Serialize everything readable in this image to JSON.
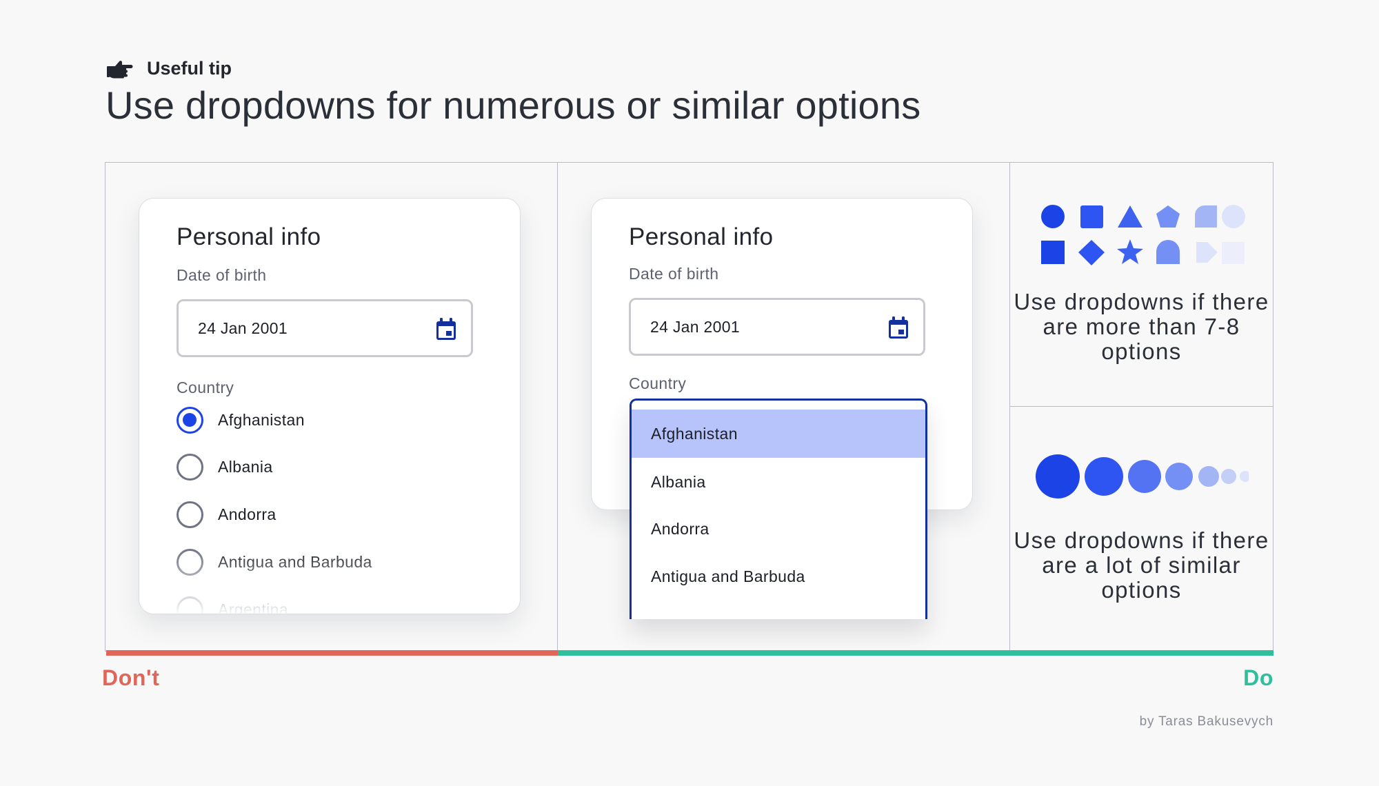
{
  "header": {
    "tip_label": "Useful tip",
    "title": "Use dropdowns for numerous or similar options"
  },
  "dont_example": {
    "card_title": "Personal info",
    "date_label": "Date of birth",
    "date_value": "24 Jan 2001",
    "country_label": "Country",
    "radio_options": [
      {
        "label": "Afghanistan",
        "checked": true
      },
      {
        "label": "Albania",
        "checked": false
      },
      {
        "label": "Andorra",
        "checked": false
      },
      {
        "label": "Antigua and Barbuda",
        "checked": false
      },
      {
        "label": "Argentina",
        "checked": false
      }
    ]
  },
  "do_example": {
    "card_title": "Personal info",
    "date_label": "Date of birth",
    "date_value": "24 Jan 2001",
    "country_label": "Country",
    "dropdown_options": [
      {
        "label": "Afghanistan",
        "selected": true
      },
      {
        "label": "Albania",
        "selected": false
      },
      {
        "label": "Andorra",
        "selected": false
      },
      {
        "label": "Antigua and Barbuda",
        "selected": false
      }
    ]
  },
  "tips": {
    "many_options_caption": "Use dropdowns if there are more than 7-8 options",
    "similar_options_caption": "Use dropdowns if there are a lot of similar options",
    "shape_icons": [
      "circle",
      "square",
      "triangle",
      "pentagon",
      "rounded-square",
      "circle",
      "square",
      "diamond",
      "star",
      "arch",
      "tag",
      "square"
    ],
    "icon_colors": [
      "#1c43e6",
      "#2e55f2",
      "#3e62f0",
      "#7590f4",
      "#a4b5f6",
      "#dde3fa"
    ]
  },
  "footer": {
    "dont_label": "Don't",
    "do_label": "Do",
    "credit": "by Taras Bakusevych"
  },
  "colors": {
    "accent": "#1c43e6",
    "dont": "#e06659",
    "do": "#2fbf9c",
    "dropdown_border": "#14309f",
    "selected_option": "#b7c3fb"
  }
}
